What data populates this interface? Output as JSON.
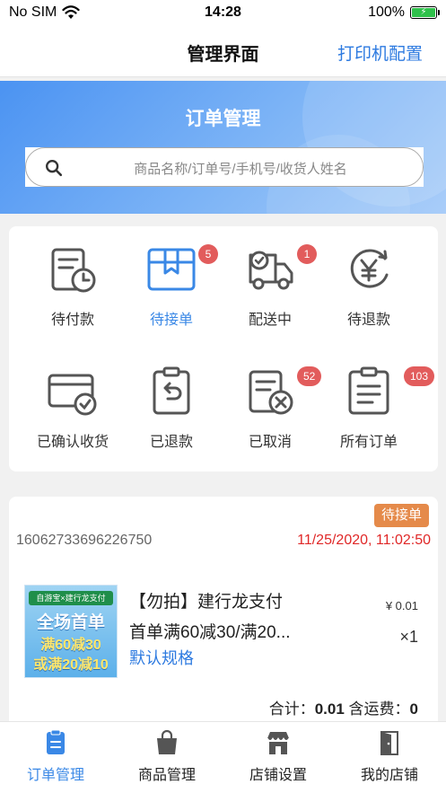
{
  "status_bar": {
    "carrier": "No SIM",
    "time": "14:28",
    "battery_text": "100%"
  },
  "nav": {
    "title": "管理界面",
    "action": "打印机配置"
  },
  "banner": {
    "title": "订单管理",
    "search_placeholder": "商品名称/订单号/手机号/收货人姓名"
  },
  "statuses": [
    {
      "label": "待付款",
      "icon": "pending-payment-icon",
      "badge": ""
    },
    {
      "label": "待接单",
      "icon": "pending-accept-icon",
      "badge": "5",
      "active": true
    },
    {
      "label": "配送中",
      "icon": "delivery-truck-icon",
      "badge": "1"
    },
    {
      "label": "待退款",
      "icon": "pending-refund-icon",
      "badge": ""
    },
    {
      "label": "已确认收货",
      "icon": "confirmed-receipt-icon",
      "badge": ""
    },
    {
      "label": "已退款",
      "icon": "refunded-icon",
      "badge": ""
    },
    {
      "label": "已取消",
      "icon": "cancelled-icon",
      "badge": "52"
    },
    {
      "label": "所有订单",
      "icon": "all-orders-icon",
      "badge": "103"
    }
  ],
  "order": {
    "status_tag": "待接单",
    "order_no": "16062733696226750",
    "time": "11/25/2020, 11:02:50",
    "product": {
      "image_top": "自游宝×建行龙支付",
      "image_line1": "全场首单",
      "image_line2": "满60减30",
      "image_line3": "或满20减10",
      "name_line1": "【勿拍】建行龙支付",
      "name_line2": "首单满60减30/满20...",
      "spec": "默认规格",
      "price": "¥ 0.01",
      "qty": "×1"
    },
    "total_label": "合计：",
    "total_value": "0.01",
    "shipping_label": "含运费：",
    "shipping_value": "0"
  },
  "tabs": [
    {
      "label": "订单管理",
      "icon": "order-clipboard-icon",
      "active": true
    },
    {
      "label": "商品管理",
      "icon": "shopping-bag-icon"
    },
    {
      "label": "店铺设置",
      "icon": "store-icon"
    },
    {
      "label": "我的店铺",
      "icon": "door-icon"
    }
  ],
  "colors": {
    "accent": "#3a88e6",
    "badge": "#e25c5c",
    "tag": "#e58a4a",
    "time_red": "#e02828"
  }
}
